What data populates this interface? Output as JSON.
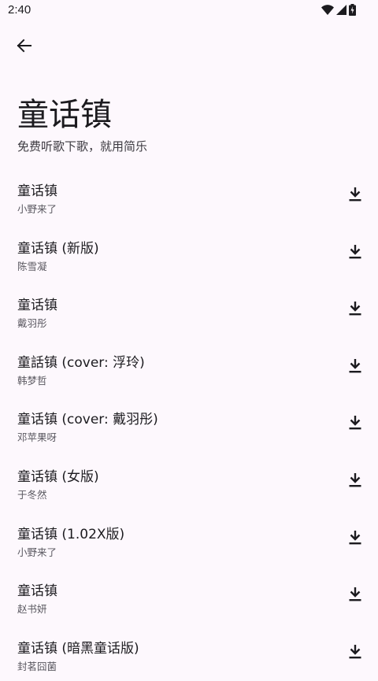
{
  "status_bar": {
    "time": "2:40",
    "icons": [
      "wifi-icon",
      "cell-signal-icon",
      "battery-charging-icon"
    ]
  },
  "header": {
    "back_icon": "arrow-back-icon",
    "title": "童话镇",
    "subtitle": "免费听歌下歌，就用简乐"
  },
  "songs": [
    {
      "title": "童话镇",
      "artist": "小野来了"
    },
    {
      "title": "童话镇 (新版)",
      "artist": "陈雪凝"
    },
    {
      "title": "童话镇",
      "artist": "戴羽彤"
    },
    {
      "title": "童話镇 (cover: 浮玲)",
      "artist": "韩梦哲"
    },
    {
      "title": "童话镇 (cover: 戴羽彤)",
      "artist": "邓苹果呀"
    },
    {
      "title": "童话镇 (女版)",
      "artist": "于冬然"
    },
    {
      "title": "童话镇 (1.02X版)",
      "artist": "小野来了"
    },
    {
      "title": "童话镇",
      "artist": "赵书妍"
    },
    {
      "title": "童话镇 (暗黑童话版)",
      "artist": "封茗囧菌"
    }
  ],
  "download_icon": "download-icon"
}
